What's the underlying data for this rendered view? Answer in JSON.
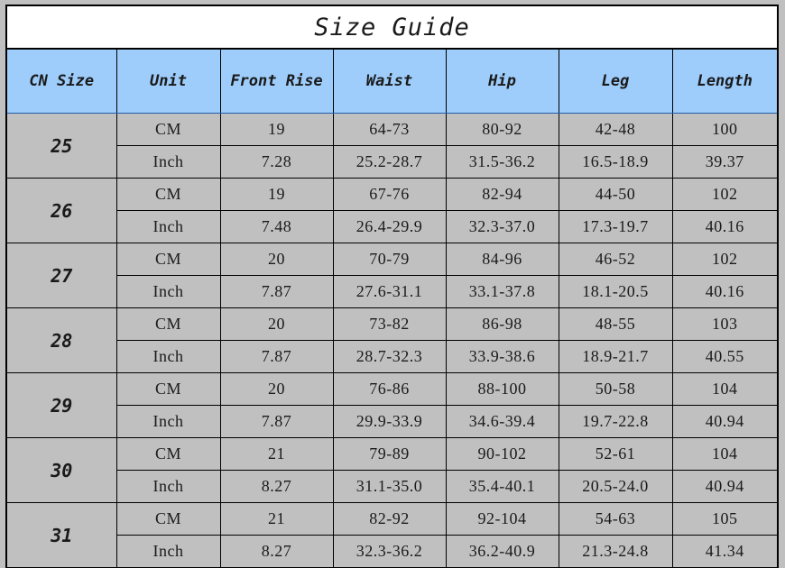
{
  "title": "Size Guide",
  "columns": [
    "CN Size",
    "Unit",
    "Front Rise",
    "Waist",
    "Hip",
    "Leg",
    "Length"
  ],
  "units": [
    "CM",
    "Inch"
  ],
  "colors": {
    "header_background": "#9ecdfb",
    "body_background": "#c0c0c0",
    "title_background": "#ffffff",
    "border": "#000000",
    "text": "#1a1a1a"
  },
  "rows": [
    {
      "cn_size": "25",
      "cm": {
        "unit": "CM",
        "front_rise": "19",
        "waist": "64-73",
        "hip": "80-92",
        "leg": "42-48",
        "length": "100"
      },
      "inch": {
        "unit": "Inch",
        "front_rise": "7.28",
        "waist": "25.2-28.7",
        "hip": "31.5-36.2",
        "leg": "16.5-18.9",
        "length": "39.37"
      }
    },
    {
      "cn_size": "26",
      "cm": {
        "unit": "CM",
        "front_rise": "19",
        "waist": "67-76",
        "hip": "82-94",
        "leg": "44-50",
        "length": "102"
      },
      "inch": {
        "unit": "Inch",
        "front_rise": "7.48",
        "waist": "26.4-29.9",
        "hip": "32.3-37.0",
        "leg": "17.3-19.7",
        "length": "40.16"
      }
    },
    {
      "cn_size": "27",
      "cm": {
        "unit": "CM",
        "front_rise": "20",
        "waist": "70-79",
        "hip": "84-96",
        "leg": "46-52",
        "length": "102"
      },
      "inch": {
        "unit": "Inch",
        "front_rise": "7.87",
        "waist": "27.6-31.1",
        "hip": "33.1-37.8",
        "leg": "18.1-20.5",
        "length": "40.16"
      }
    },
    {
      "cn_size": "28",
      "cm": {
        "unit": "CM",
        "front_rise": "20",
        "waist": "73-82",
        "hip": "86-98",
        "leg": "48-55",
        "length": "103"
      },
      "inch": {
        "unit": "Inch",
        "front_rise": "7.87",
        "waist": "28.7-32.3",
        "hip": "33.9-38.6",
        "leg": "18.9-21.7",
        "length": "40.55"
      }
    },
    {
      "cn_size": "29",
      "cm": {
        "unit": "CM",
        "front_rise": "20",
        "waist": "76-86",
        "hip": "88-100",
        "leg": "50-58",
        "length": "104"
      },
      "inch": {
        "unit": "Inch",
        "front_rise": "7.87",
        "waist": "29.9-33.9",
        "hip": "34.6-39.4",
        "leg": "19.7-22.8",
        "length": "40.94"
      }
    },
    {
      "cn_size": "30",
      "cm": {
        "unit": "CM",
        "front_rise": "21",
        "waist": "79-89",
        "hip": "90-102",
        "leg": "52-61",
        "length": "104"
      },
      "inch": {
        "unit": "Inch",
        "front_rise": "8.27",
        "waist": "31.1-35.0",
        "hip": "35.4-40.1",
        "leg": "20.5-24.0",
        "length": "40.94"
      }
    },
    {
      "cn_size": "31",
      "cm": {
        "unit": "CM",
        "front_rise": "21",
        "waist": "82-92",
        "hip": "92-104",
        "leg": "54-63",
        "length": "105"
      },
      "inch": {
        "unit": "Inch",
        "front_rise": "8.27",
        "waist": "32.3-36.2",
        "hip": "36.2-40.9",
        "leg": "21.3-24.8",
        "length": "41.34"
      }
    }
  ]
}
